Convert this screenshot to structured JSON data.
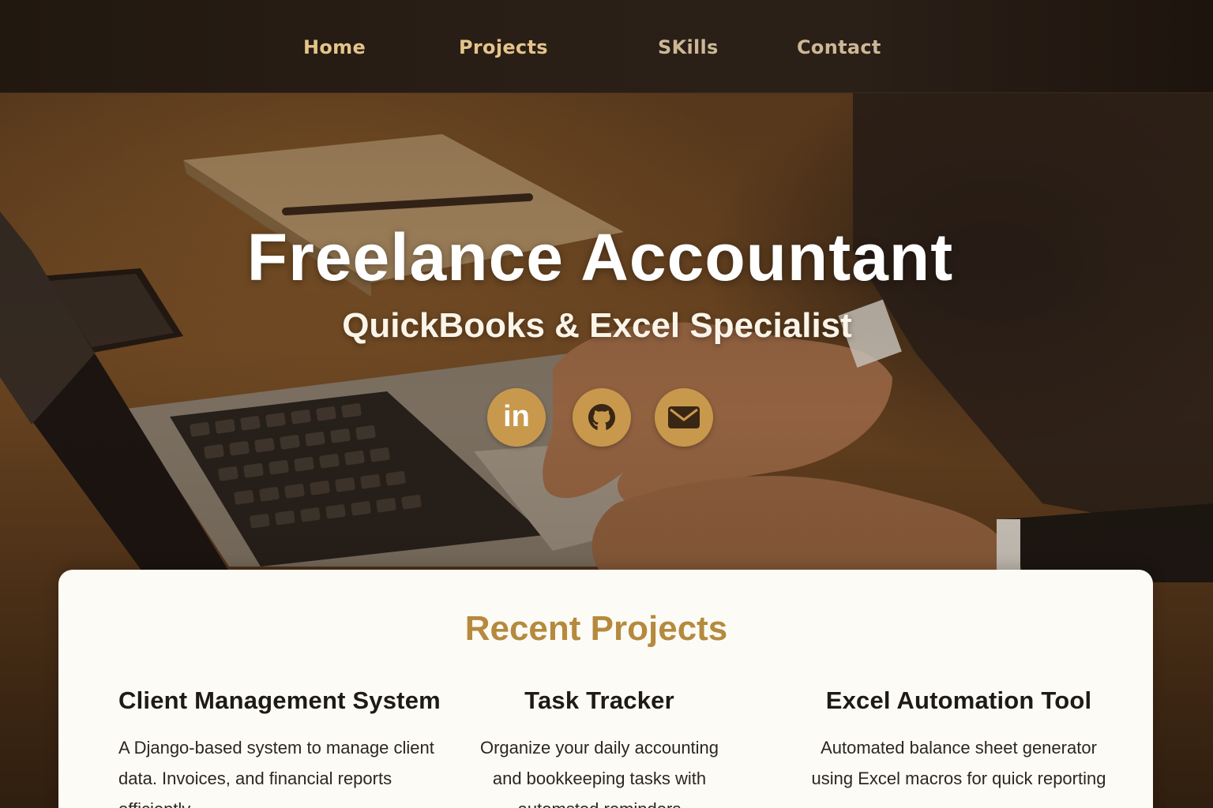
{
  "nav": {
    "items": [
      {
        "label": "Home"
      },
      {
        "label": "Projects"
      },
      {
        "label": "SKills"
      },
      {
        "label": "Contact"
      }
    ]
  },
  "hero": {
    "title": "Freelance Accountant",
    "subtitle": "QuickBooks & Excel Specialist",
    "social": [
      {
        "icon": "linkedin-icon",
        "text": "in"
      },
      {
        "icon": "github-icon"
      },
      {
        "icon": "mail-icon"
      }
    ]
  },
  "projects": {
    "heading": "Recent Projects",
    "items": [
      {
        "title": "Client Management System",
        "description": "A Django-based system to manage client data. Invoices, and financial reports officiently"
      },
      {
        "title": "Task Tracker",
        "description": "Organize your daily accounting and bookkeeping tasks with automsted reminders"
      },
      {
        "title": "Excel Automation Tool",
        "description": "Automated balance sheet generator using Excel macros for quick reporting"
      }
    ]
  },
  "colors": {
    "accent": "#c8994d",
    "heading_gold": "#b58a3e",
    "nav_text": "#e4c48a",
    "card_bg": "#fdfbf6"
  }
}
